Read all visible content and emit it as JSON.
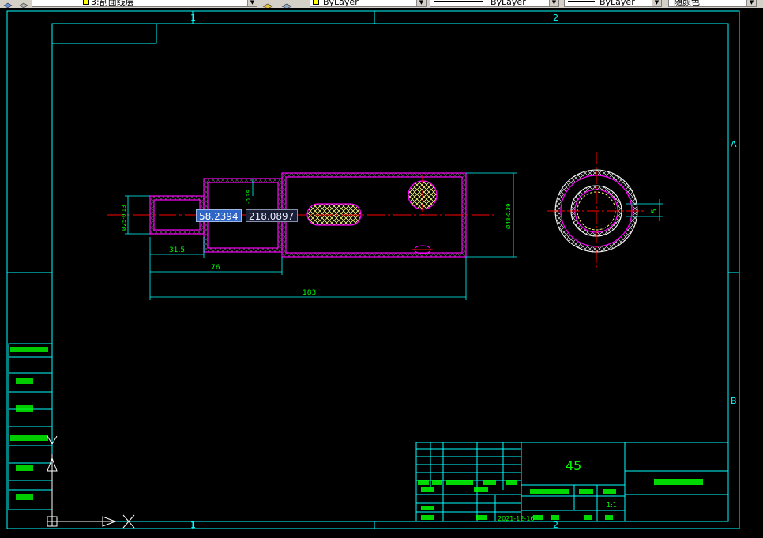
{
  "toolbar": {
    "layer_name": "3:剖面线层",
    "color_value": "ByLayer",
    "linetype_value": "ByLayer",
    "lineweight_value": "ByLayer",
    "plotstyle_value": "随颜色"
  },
  "frame": {
    "zone_top_1": "1",
    "zone_top_2": "2",
    "zone_bottom_1": "1",
    "zone_bottom_2": "2",
    "zone_right_a": "A",
    "zone_right_b": "B"
  },
  "drawing": {
    "dim_diameter_left": "Ø25-0.13",
    "dim_step": "-0.39",
    "dim_diameter_right": "Ø48-0.39",
    "dim_31_5": "31.5",
    "dim_76": "76",
    "dim_183": "183",
    "dim_5": "5"
  },
  "dynamic_input": {
    "length_value": "58.2394",
    "angle_value": "218.0897"
  },
  "title_block": {
    "material": "45",
    "drawing_name": "轴",
    "scale": "1:1",
    "date": "2021-12-16"
  },
  "colors": {
    "background": "#000000",
    "frame": "#00ffff",
    "outline": "#ff00ff",
    "hatch": "#ffffff",
    "centerline": "#ff0000",
    "text": "#00ff00",
    "yellow": "#ffff00"
  }
}
